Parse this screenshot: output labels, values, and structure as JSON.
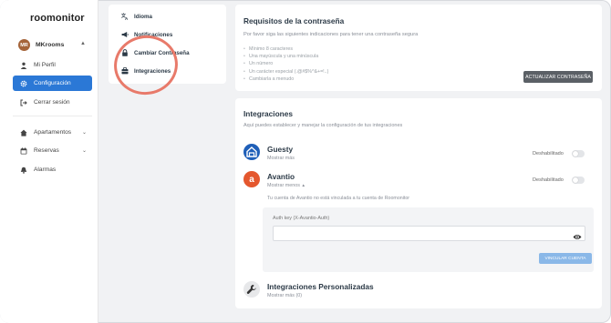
{
  "app": {
    "brand": "roomonitor"
  },
  "user": {
    "initials": "MR",
    "name": "MKrooms"
  },
  "sidebar": {
    "items": [
      {
        "label": "Mi Perfil",
        "icon": "user-icon"
      },
      {
        "label": "Configuración",
        "icon": "gear-icon"
      },
      {
        "label": "Cerrar sesión",
        "icon": "logout-icon"
      },
      {
        "label": "Apartamentos",
        "icon": "home-icon"
      },
      {
        "label": "Reservas",
        "icon": "calendar-icon"
      },
      {
        "label": "Alarmas",
        "icon": "bell-icon"
      }
    ]
  },
  "subnav": {
    "items": [
      {
        "label": "Idioma",
        "icon": "translate-icon"
      },
      {
        "label": "Notificaciones",
        "icon": "megaphone-icon"
      },
      {
        "label": "Cambiar Contraseña",
        "icon": "lock-icon"
      },
      {
        "label": "Integraciones",
        "icon": "integrations-icon"
      }
    ]
  },
  "password": {
    "title": "Requisitos de la contraseña",
    "subtitle": "Por favor siga las siguientes indicaciones para tener una contraseña segura",
    "requirements": [
      "Mínimo 8 caracteres",
      "Una mayúscula y una minúscula",
      "Un número",
      "Un carácter especial (.@#$%^&+=!..)",
      "Cambiarla a menudo"
    ],
    "button": "ACTUALIZAR CONTRASEÑA"
  },
  "integrations": {
    "title": "Integraciones",
    "subtitle": "Aquí puedes establecer y manejar la configuración de tus integraciones",
    "guesty": {
      "name": "Guesty",
      "link": "Mostrar más",
      "status": "Deshabilitado",
      "enabled": false
    },
    "avantio": {
      "name": "Avantio",
      "link": "Mostrar menos",
      "status": "Deshabilitado",
      "enabled": false,
      "info": "Tu cuenta de Avantio no está vinculada a tu cuenta de Roomonitor",
      "auth_label": "Auth key (X-Avantio-Auth)",
      "auth_value": "",
      "button": "VINCULAR CUENTA"
    },
    "custom": {
      "name": "Integraciones Personalizadas",
      "link": "Mostrar más (0)"
    }
  },
  "colors": {
    "accent": "#2b78d6",
    "annotation": "#e87a6a",
    "avantio": "#e4572e",
    "guesty": "#1f5fb8"
  }
}
